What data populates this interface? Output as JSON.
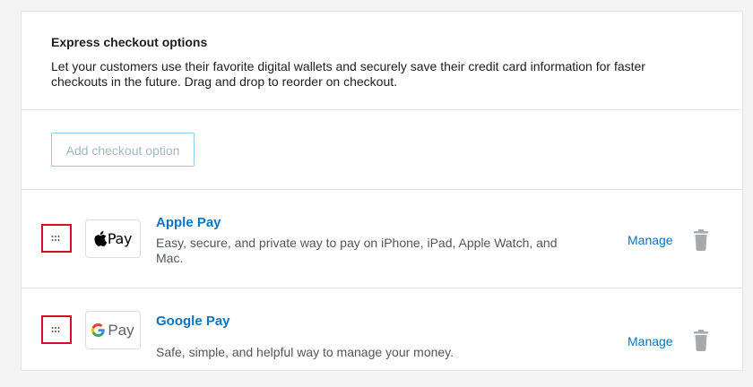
{
  "section": {
    "title": "Express checkout options",
    "description": "Let your customers use their favorite digital wallets and securely save their credit card information for faster checkouts in the future. Drag and drop to reorder on checkout."
  },
  "add_button": {
    "label": "Add checkout option"
  },
  "methods": [
    {
      "name": "Apple Pay",
      "logo_text": "Pay",
      "logo_glyph": "apple-logo",
      "description": "Easy, secure, and private way to pay on iPhone, iPad, Apple Watch, and Mac.",
      "manage_label": "Manage"
    },
    {
      "name": "Google Pay",
      "logo_text": "Pay",
      "logo_glyph": "google-g-logo",
      "description": "Safe, simple, and helpful way to manage your money.",
      "manage_label": "Manage"
    }
  ],
  "icons": {
    "drag": "drag-handle-icon",
    "delete": "trash-icon"
  },
  "colors": {
    "link": "#0675c4",
    "highlight_border": "#d4111e",
    "add_button_border": "#8fd0e6",
    "muted_text": "#50575e"
  }
}
